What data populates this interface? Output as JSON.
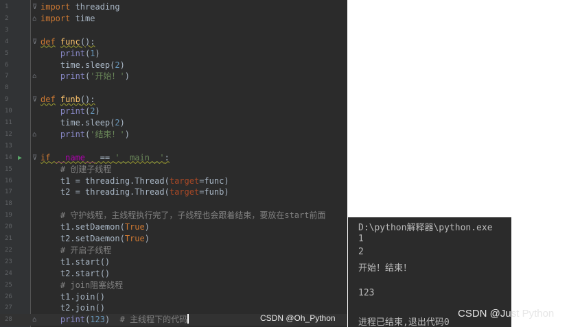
{
  "editor": {
    "lines": [
      {
        "num": "1",
        "tokens": [
          {
            "t": "import",
            "c": "kw"
          },
          {
            "t": " threading",
            "c": ""
          }
        ]
      },
      {
        "num": "2",
        "tokens": [
          {
            "t": "import",
            "c": "kw"
          },
          {
            "t": " time",
            "c": ""
          }
        ]
      },
      {
        "num": "3",
        "tokens": []
      },
      {
        "num": "4",
        "tokens": [
          {
            "t": "def",
            "c": "kw wavy"
          },
          {
            "t": " ",
            "c": ""
          },
          {
            "t": "func",
            "c": "fn wavy"
          },
          {
            "t": "():",
            "c": "wavy"
          }
        ]
      },
      {
        "num": "5",
        "tokens": [
          {
            "t": "    ",
            "c": ""
          },
          {
            "t": "print",
            "c": "bi"
          },
          {
            "t": "(",
            "c": ""
          },
          {
            "t": "1",
            "c": "num"
          },
          {
            "t": ")",
            "c": ""
          }
        ]
      },
      {
        "num": "6",
        "tokens": [
          {
            "t": "    time.sleep(",
            "c": ""
          },
          {
            "t": "2",
            "c": "num"
          },
          {
            "t": ")",
            "c": ""
          }
        ]
      },
      {
        "num": "7",
        "tokens": [
          {
            "t": "    ",
            "c": ""
          },
          {
            "t": "print",
            "c": "bi"
          },
          {
            "t": "(",
            "c": ""
          },
          {
            "t": "'开始！'",
            "c": "str"
          },
          {
            "t": ")",
            "c": ""
          }
        ]
      },
      {
        "num": "8",
        "tokens": []
      },
      {
        "num": "9",
        "tokens": [
          {
            "t": "def",
            "c": "kw wavy"
          },
          {
            "t": " ",
            "c": ""
          },
          {
            "t": "funb",
            "c": "fn wavy"
          },
          {
            "t": "():",
            "c": "wavy"
          }
        ]
      },
      {
        "num": "10",
        "tokens": [
          {
            "t": "    ",
            "c": ""
          },
          {
            "t": "print",
            "c": "bi"
          },
          {
            "t": "(",
            "c": ""
          },
          {
            "t": "2",
            "c": "num"
          },
          {
            "t": ")",
            "c": ""
          }
        ]
      },
      {
        "num": "11",
        "tokens": [
          {
            "t": "    time.sleep(",
            "c": ""
          },
          {
            "t": "2",
            "c": "num"
          },
          {
            "t": ")",
            "c": ""
          }
        ]
      },
      {
        "num": "12",
        "tokens": [
          {
            "t": "    ",
            "c": ""
          },
          {
            "t": "print",
            "c": "bi"
          },
          {
            "t": "(",
            "c": ""
          },
          {
            "t": "'结束！'",
            "c": "str"
          },
          {
            "t": ")",
            "c": ""
          }
        ]
      },
      {
        "num": "13",
        "tokens": []
      },
      {
        "num": "14",
        "tokens": [
          {
            "t": "if",
            "c": "kw wavy"
          },
          {
            "t": " ",
            "c": "wavy"
          },
          {
            "t": "__name__",
            "c": "magic wavy"
          },
          {
            "t": " == ",
            "c": "wavy"
          },
          {
            "t": "'__main__'",
            "c": "str wavy"
          },
          {
            "t": ":",
            "c": "wavy"
          }
        ]
      },
      {
        "num": "15",
        "tokens": [
          {
            "t": "    # 创建子线程",
            "c": "cm"
          }
        ]
      },
      {
        "num": "16",
        "tokens": [
          {
            "t": "    t1 = threading.Thread(",
            "c": ""
          },
          {
            "t": "target",
            "c": "param"
          },
          {
            "t": "=func)",
            "c": ""
          }
        ]
      },
      {
        "num": "17",
        "tokens": [
          {
            "t": "    t2 = threading.Thread(",
            "c": ""
          },
          {
            "t": "target",
            "c": "param"
          },
          {
            "t": "=funb)",
            "c": ""
          }
        ]
      },
      {
        "num": "18",
        "tokens": []
      },
      {
        "num": "19",
        "tokens": [
          {
            "t": "    # 守护线程，主线程执行完了，子线程也会跟着结束，要放在start前面",
            "c": "cm"
          }
        ]
      },
      {
        "num": "20",
        "tokens": [
          {
            "t": "    t1.setDaemon(",
            "c": ""
          },
          {
            "t": "True",
            "c": "kw"
          },
          {
            "t": ")",
            "c": ""
          }
        ]
      },
      {
        "num": "21",
        "tokens": [
          {
            "t": "    t2.setDaemon(",
            "c": ""
          },
          {
            "t": "True",
            "c": "kw"
          },
          {
            "t": ")",
            "c": ""
          }
        ]
      },
      {
        "num": "22",
        "tokens": [
          {
            "t": "    # 开启子线程",
            "c": "cm"
          }
        ]
      },
      {
        "num": "23",
        "tokens": [
          {
            "t": "    t1.start()",
            "c": ""
          }
        ]
      },
      {
        "num": "24",
        "tokens": [
          {
            "t": "    t2.start()",
            "c": ""
          }
        ]
      },
      {
        "num": "25",
        "tokens": [
          {
            "t": "    # join阻塞线程",
            "c": "cm"
          }
        ]
      },
      {
        "num": "26",
        "tokens": [
          {
            "t": "    t1.join()",
            "c": ""
          }
        ]
      },
      {
        "num": "27",
        "tokens": [
          {
            "t": "    t2.join()",
            "c": ""
          }
        ]
      },
      {
        "num": "28",
        "tokens": [
          {
            "t": "    ",
            "c": ""
          },
          {
            "t": "print",
            "c": "bi"
          },
          {
            "t": "(",
            "c": ""
          },
          {
            "t": "123",
            "c": "num"
          },
          {
            "t": ")",
            "c": ""
          },
          {
            "t": "  # 主线程下的代码",
            "c": "cm"
          }
        ]
      }
    ],
    "fold_markers": {
      "1": "⊽",
      "2": "⌂",
      "4": "⊽",
      "7": "⌂",
      "9": "⊽",
      "12": "⌂",
      "14": "⊽",
      "28": "⌂"
    },
    "run_marker_line": "14",
    "current_line": "28",
    "watermark": "CSDN @Oh_Python"
  },
  "console": {
    "lines": [
      "D:\\python解释器\\python.exe",
      "1",
      "2",
      "开始！结束！",
      "",
      "123",
      "",
      "进程已结束,退出代码0"
    ]
  },
  "watermark_right": "CSDN @Just Python",
  "colors": {
    "editor_bg": "#2b2b2b",
    "gutter_bg": "#313335",
    "keyword": "#cc7832",
    "function": "#ffc66d",
    "string": "#6a8759",
    "number": "#6897bb",
    "builtin": "#8888c6",
    "comment": "#808080"
  }
}
